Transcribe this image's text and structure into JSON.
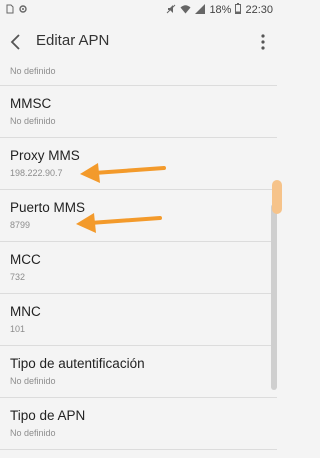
{
  "status_bar": {
    "battery": "18%",
    "time": "22:30",
    "icons": [
      "sim-icon",
      "settings-icon",
      "mute-icon",
      "wifi-icon",
      "signal-icon",
      "battery-icon"
    ]
  },
  "toolbar": {
    "title": "Editar APN",
    "back_icon": "back-arrow-icon",
    "more_icon": "more-vert-icon"
  },
  "list": {
    "partial_top_value": "No definido",
    "items": [
      {
        "label": "MMSC",
        "value": "No definido"
      },
      {
        "label": "Proxy MMS",
        "value": "198.222.90.7"
      },
      {
        "label": "Puerto MMS",
        "value": "8799"
      },
      {
        "label": "MCC",
        "value": "732"
      },
      {
        "label": "MNC",
        "value": "101"
      },
      {
        "label": "Tipo de autentificación",
        "value": "No definido"
      },
      {
        "label": "Tipo de APN",
        "value": "No definido"
      }
    ]
  },
  "colors": {
    "background": "#f4f4f4",
    "arrow": "#f39a2b",
    "divider": "#dcdcdc"
  }
}
